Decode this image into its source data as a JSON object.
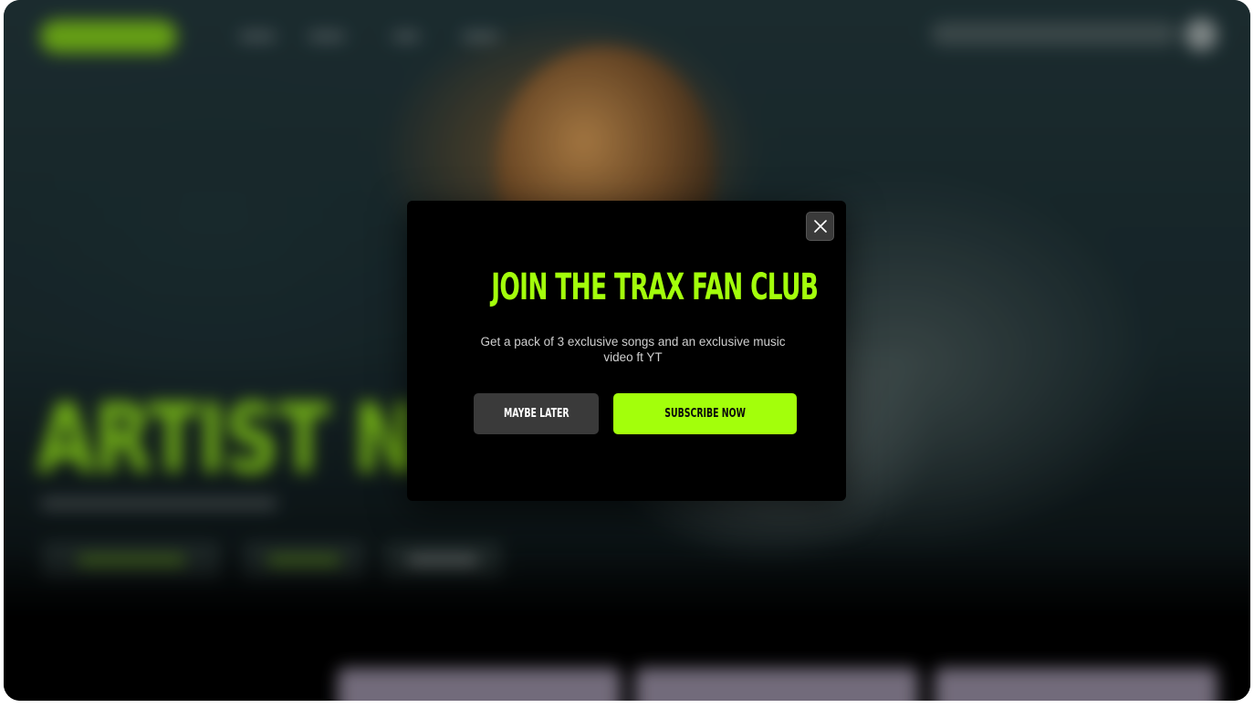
{
  "colors": {
    "accent": "#a3ff0b",
    "modal_background": "#000000",
    "secondary_button": "#3a3a3a"
  },
  "modal": {
    "title": "JOIN THE TRAX FAN CLUB",
    "description": "Get a pack of 3 exclusive songs and an exclusive music video ft YT",
    "close_icon": "close-icon",
    "secondary_button_label": "MAYBE LATER",
    "primary_button_label": "SUBSCRIBE NOW"
  },
  "background": {
    "hero_title": "ARTIST NAI"
  }
}
